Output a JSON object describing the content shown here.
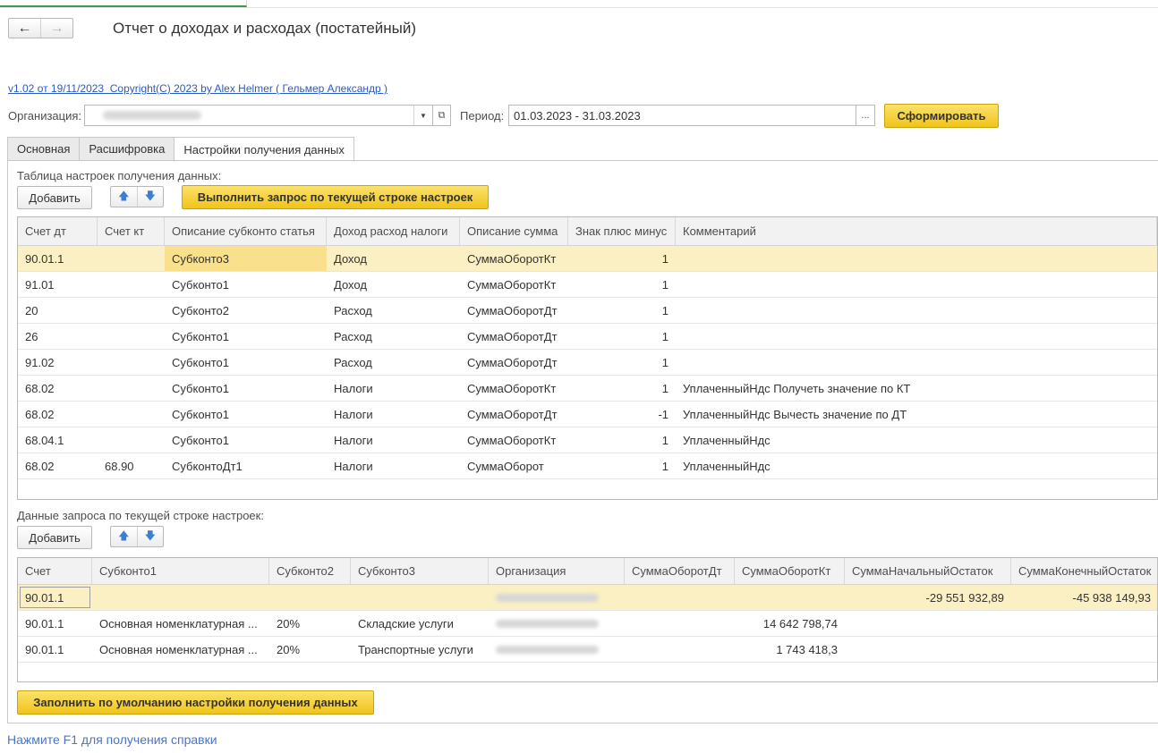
{
  "window": {
    "title": "Отчет о доходах и расходах (постатейный)",
    "back_icon": "arrow-left",
    "forward_icon": "arrow-right"
  },
  "version_link": "v1.02 от 19/11/2023  Copyright(C) 2023 by Alex Helmer ( Гельмер Александр )",
  "filters": {
    "org_label": "Организация:",
    "org_value": "",
    "period_label": "Период:",
    "period_value": "01.03.2023 - 31.03.2023",
    "period_btn": "...",
    "generate_btn": "Сформировать"
  },
  "tabs": [
    {
      "label": "Основная"
    },
    {
      "label": "Расшифровка"
    },
    {
      "label": "Настройки получения данных"
    }
  ],
  "settings": {
    "caption": "Таблица настроек получения данных:",
    "add_btn": "Добавить",
    "run_btn": "Выполнить запрос по текущей строке настроек",
    "columns": [
      "Счет дт",
      "Счет кт",
      "Описание субконто статья",
      "Доход расход налоги",
      "Описание сумма",
      "Знак плюс минус",
      "Комментарий"
    ],
    "rows": [
      [
        "90.01.1",
        "",
        "Субконто3",
        "Доход",
        "СуммаОборотКт",
        "1",
        ""
      ],
      [
        "91.01",
        "",
        "Субконто1",
        "Доход",
        "СуммаОборотКт",
        "1",
        ""
      ],
      [
        "20",
        "",
        "Субконто2",
        "Расход",
        "СуммаОборотДт",
        "1",
        ""
      ],
      [
        "26",
        "",
        "Субконто1",
        "Расход",
        "СуммаОборотДт",
        "1",
        ""
      ],
      [
        "91.02",
        "",
        "Субконто1",
        "Расход",
        "СуммаОборотДт",
        "1",
        ""
      ],
      [
        "68.02",
        "",
        "Субконто1",
        "Налоги",
        "СуммаОборотКт",
        "1",
        "УплаченныйНдс Получеть значение по КТ"
      ],
      [
        "68.02",
        "",
        "Субконто1",
        "Налоги",
        "СуммаОборотДт",
        "-1",
        "УплаченныйНдс Вычесть значение по ДТ"
      ],
      [
        "68.04.1",
        "",
        "Субконто1",
        "Налоги",
        "СуммаОборотКт",
        "1",
        "УплаченныйНдс"
      ],
      [
        "68.02",
        "68.90",
        "СубконтоДт1",
        "Налоги",
        "СуммаОборот",
        "1",
        "УплаченныйНдс"
      ]
    ]
  },
  "query": {
    "caption": "Данные запроса по текущей строке настроек:",
    "add_btn": "Добавить",
    "columns": [
      "Счет",
      "Субконто1",
      "Субконто2",
      "Субконто3",
      "Организация",
      "СуммаОборотДт",
      "СуммаОборотКт",
      "СуммаНачальныйОстаток",
      "СуммаКонечныйОстаток"
    ],
    "rows": [
      [
        "90.01.1",
        "",
        "",
        "",
        "",
        "",
        "",
        "-29 551 932,89",
        "-45 938 149,93"
      ],
      [
        "90.01.1",
        "Основная номенклатурная ...",
        "20%",
        "Складские услуги",
        "",
        "",
        "14 642 798,74",
        "",
        ""
      ],
      [
        "90.01.1",
        "Основная номенклатурная ...",
        "20%",
        "Транспортные услуги",
        "",
        "",
        "1 743 418,3",
        "",
        ""
      ]
    ]
  },
  "fill_default_btn": "Заполнить по умолчанию настройки получения данных",
  "help_text": "Нажмите F1 для получения справки",
  "colors": {
    "accent_yellow": "#f0c41b",
    "selected_row": "#fbf0c3",
    "link": "#2b5bbf"
  }
}
